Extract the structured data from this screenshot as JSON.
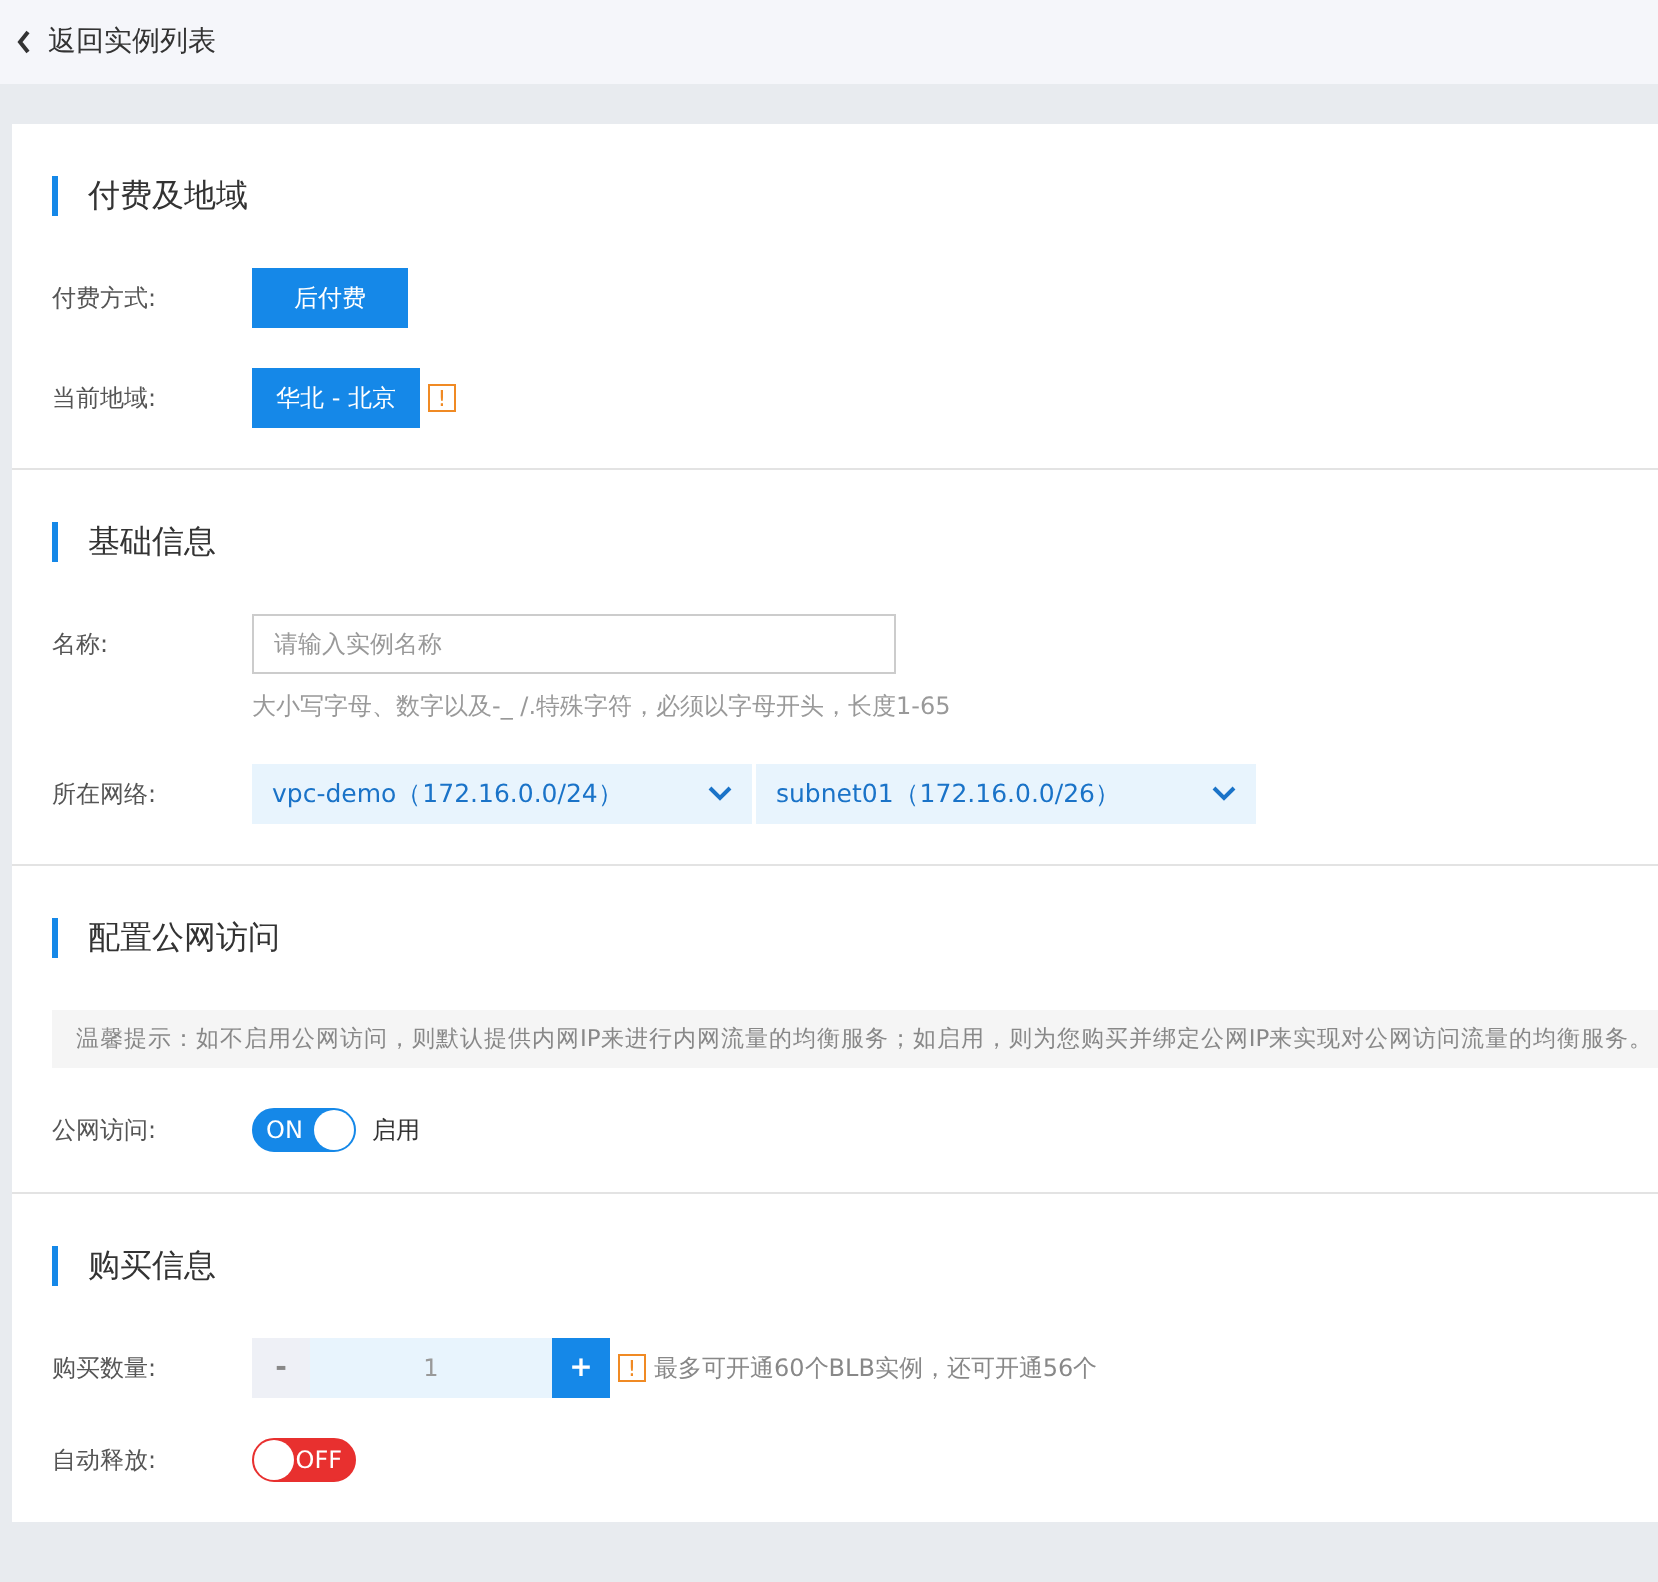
{
  "back_link": {
    "label": "返回实例列表"
  },
  "sections": [
    {
      "title": "付费及地域",
      "rows": [
        {
          "kind": "button",
          "label": "付费方式:",
          "text": "后付费"
        },
        {
          "kind": "button",
          "label": "当前地域:",
          "text": "华北 - 北京",
          "warning": "!"
        }
      ]
    },
    {
      "title": "基础信息",
      "rows": [
        {
          "kind": "input",
          "label": "名称:",
          "placeholder": "请输入实例名称",
          "hint": "大小写字母、数字以及-_ /.特殊字符，必须以字母开头，长度1-65"
        },
        {
          "kind": "selects",
          "label": "所在网络:",
          "options": [
            "vpc-demo（172.16.0.0/24）",
            "subnet01（172.16.0.0/26）"
          ]
        }
      ]
    },
    {
      "title": "配置公网访问",
      "rows": [
        {
          "kind": "notice",
          "text": "温馨提示：如不启用公网访问，则默认提供内网IP来进行内网流量的均衡服务；如启用，则为您购买并绑定公网IP来实现对公网访问流量的均衡服务。"
        },
        {
          "kind": "switch",
          "label": "公网访问:",
          "on": true,
          "text": "ON",
          "state_label": "启用"
        }
      ]
    },
    {
      "title": "购买信息",
      "rows": [
        {
          "kind": "stepper",
          "label": "购买数量:",
          "minus": "-",
          "value": "1",
          "plus": "+",
          "warning": "!",
          "note": "最多可开通60个BLB实例，还可开通56个"
        },
        {
          "kind": "switch",
          "label": "自动释放:",
          "on": false,
          "text": "OFF"
        }
      ]
    }
  ]
}
